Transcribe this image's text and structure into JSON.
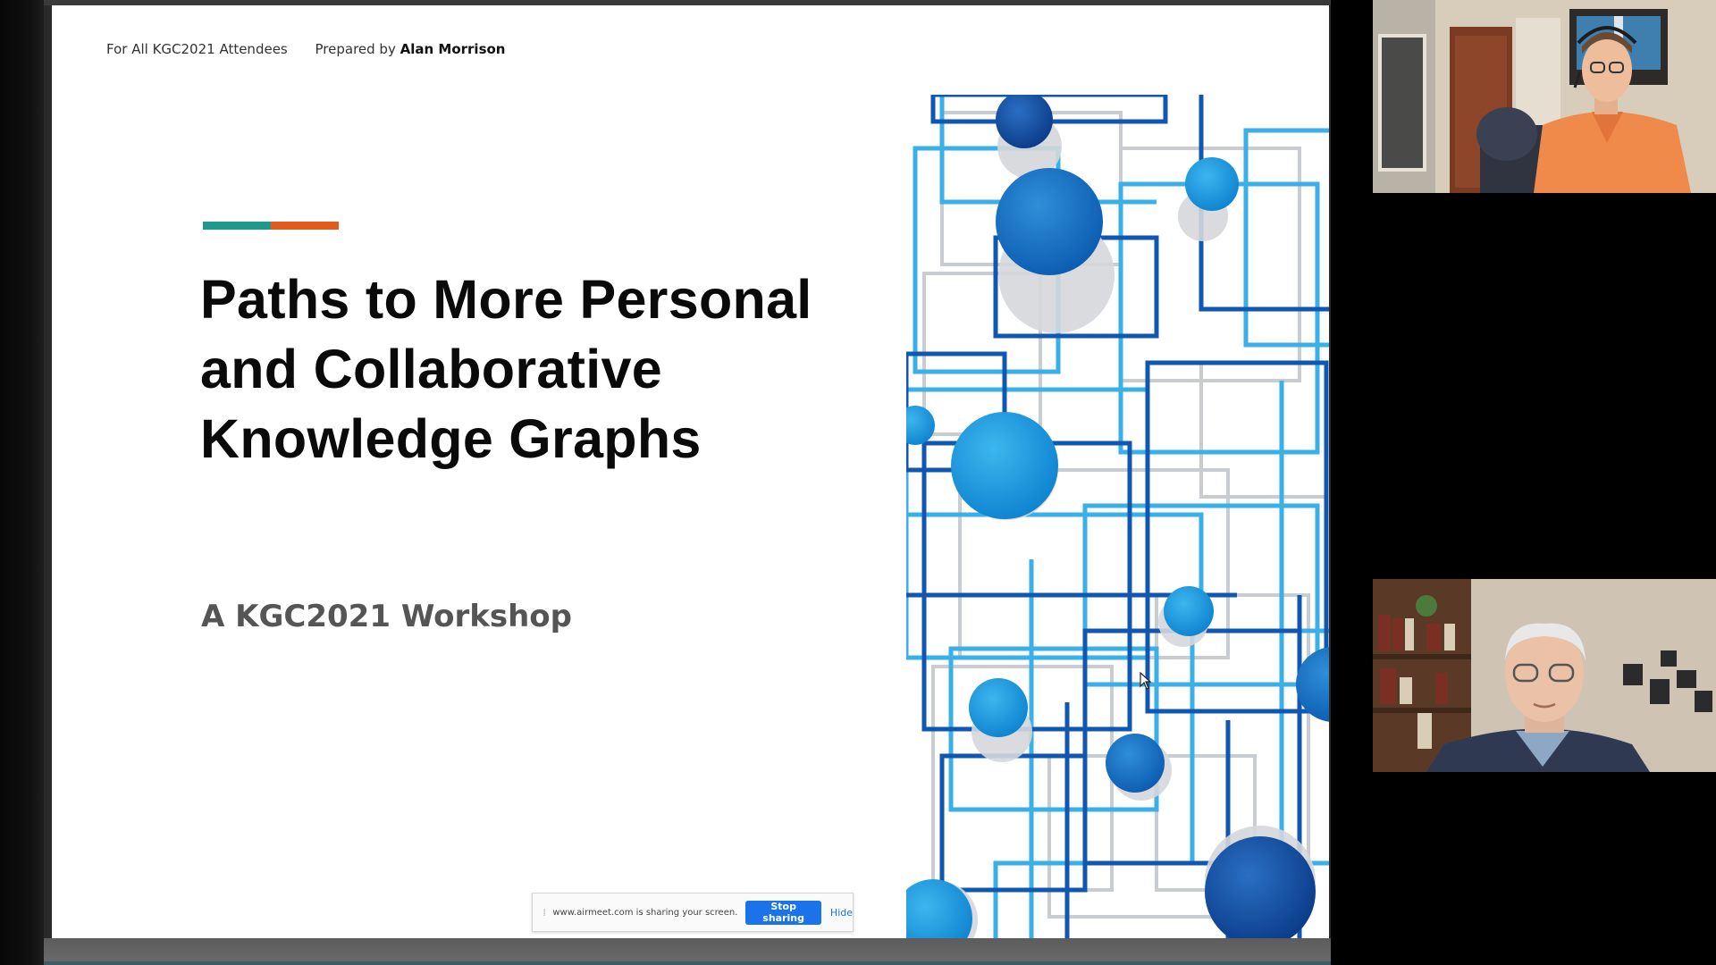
{
  "slide": {
    "header_audience": "For All KGC2021 Attendees",
    "header_prepared_prefix": "Prepared by",
    "header_author": "Alan Morrison",
    "title_lines": [
      "Paths to More Personal",
      "and Collaborative",
      "Knowledge Graphs"
    ],
    "subtitle": "A KGC2021 Workshop",
    "accent_colors": [
      "#1d9a8c",
      "#e25b1a"
    ]
  },
  "share_bar": {
    "message": "www.airmeet.com is sharing your screen.",
    "stop_label": "Stop sharing",
    "hide_label": "Hide"
  },
  "participants": [
    {
      "id": "participant-1",
      "shirt_color": "#f08a4b"
    },
    {
      "id": "participant-2",
      "shirt_color": "#2f3a52"
    }
  ],
  "colors": {
    "brand_blue": "#1a73e8",
    "network_dark": "#0a3d8a",
    "network_light": "#1ea0e0"
  }
}
